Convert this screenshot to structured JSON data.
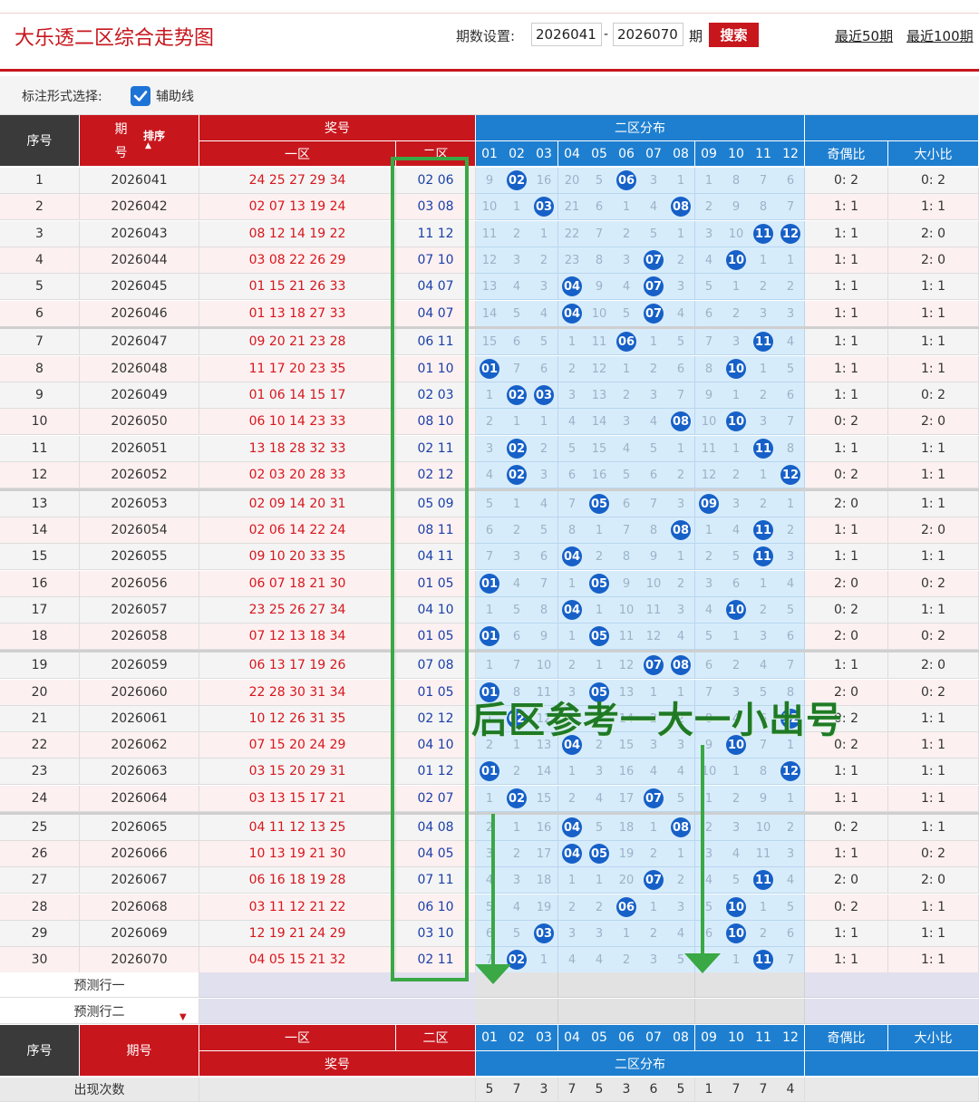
{
  "header": {
    "title": "大乐透二区综合走势图",
    "period_label": "期数设置:",
    "period_start": "2026041",
    "period_dash": "-",
    "period_end": "2026070",
    "period_unit": "期",
    "search_label": "搜索",
    "link_50": "最近50期",
    "link_100": "最近100期"
  },
  "options": {
    "label_mode": "标注形式选择:",
    "helper_line": "辅助线",
    "checked": true
  },
  "table_header": {
    "seq": "序号",
    "period_top": "期",
    "period_bottom": "号",
    "sort": "排序",
    "draw": "奖号",
    "front": "一区",
    "back": "二区",
    "zone": "二区分布",
    "zone_cols": [
      "01",
      "02",
      "03",
      "04",
      "05",
      "06",
      "07",
      "08",
      "09",
      "10",
      "11",
      "12"
    ],
    "odd_even": "奇偶比",
    "big_small": "大小比"
  },
  "rows": [
    {
      "seq": "1",
      "period": "2026041",
      "front": "24 25 27 29 34",
      "back": "02 06",
      "zone": [
        "9",
        "02",
        "16",
        "20",
        "5",
        "06",
        "3",
        "1",
        "1",
        "8",
        "7",
        "6"
      ],
      "odd_even": "0: 2",
      "big_small": "0: 2"
    },
    {
      "seq": "2",
      "period": "2026042",
      "front": "02 07 13 19 24",
      "back": "03 08",
      "zone": [
        "10",
        "1",
        "03",
        "21",
        "6",
        "1",
        "4",
        "08",
        "2",
        "9",
        "8",
        "7"
      ],
      "odd_even": "1: 1",
      "big_small": "1: 1"
    },
    {
      "seq": "3",
      "period": "2026043",
      "front": "08 12 14 19 22",
      "back": "11 12",
      "zone": [
        "11",
        "2",
        "1",
        "22",
        "7",
        "2",
        "5",
        "1",
        "3",
        "10",
        "11",
        "12"
      ],
      "odd_even": "1: 1",
      "big_small": "2: 0"
    },
    {
      "seq": "4",
      "period": "2026044",
      "front": "03 08 22 26 29",
      "back": "07 10",
      "zone": [
        "12",
        "3",
        "2",
        "23",
        "8",
        "3",
        "07",
        "2",
        "4",
        "10",
        "1",
        "1"
      ],
      "odd_even": "1: 1",
      "big_small": "2: 0"
    },
    {
      "seq": "5",
      "period": "2026045",
      "front": "01 15 21 26 33",
      "back": "04 07",
      "zone": [
        "13",
        "4",
        "3",
        "04",
        "9",
        "4",
        "07",
        "3",
        "5",
        "1",
        "2",
        "2"
      ],
      "odd_even": "1: 1",
      "big_small": "1: 1"
    },
    {
      "seq": "6",
      "period": "2026046",
      "front": "01 13 18 27 33",
      "back": "04 07",
      "zone": [
        "14",
        "5",
        "4",
        "04",
        "10",
        "5",
        "07",
        "4",
        "6",
        "2",
        "3",
        "3"
      ],
      "odd_even": "1: 1",
      "big_small": "1: 1"
    },
    {
      "seq": "7",
      "period": "2026047",
      "front": "09 20 21 23 28",
      "back": "06 11",
      "zone": [
        "15",
        "6",
        "5",
        "1",
        "11",
        "06",
        "1",
        "5",
        "7",
        "3",
        "11",
        "4"
      ],
      "odd_even": "1: 1",
      "big_small": "1: 1"
    },
    {
      "seq": "8",
      "period": "2026048",
      "front": "11 17 20 23 35",
      "back": "01 10",
      "zone": [
        "01",
        "7",
        "6",
        "2",
        "12",
        "1",
        "2",
        "6",
        "8",
        "10",
        "1",
        "5"
      ],
      "odd_even": "1: 1",
      "big_small": "1: 1"
    },
    {
      "seq": "9",
      "period": "2026049",
      "front": "01 06 14 15 17",
      "back": "02 03",
      "zone": [
        "1",
        "02",
        "03",
        "3",
        "13",
        "2",
        "3",
        "7",
        "9",
        "1",
        "2",
        "6"
      ],
      "odd_even": "1: 1",
      "big_small": "0: 2"
    },
    {
      "seq": "10",
      "period": "2026050",
      "front": "06 10 14 23 33",
      "back": "08 10",
      "zone": [
        "2",
        "1",
        "1",
        "4",
        "14",
        "3",
        "4",
        "08",
        "10",
        "10",
        "3",
        "7"
      ],
      "odd_even": "0: 2",
      "big_small": "2: 0"
    },
    {
      "seq": "11",
      "period": "2026051",
      "front": "13 18 28 32 33",
      "back": "02 11",
      "zone": [
        "3",
        "02",
        "2",
        "5",
        "15",
        "4",
        "5",
        "1",
        "11",
        "1",
        "11",
        "8"
      ],
      "odd_even": "1: 1",
      "big_small": "1: 1"
    },
    {
      "seq": "12",
      "period": "2026052",
      "front": "02 03 20 28 33",
      "back": "02 12",
      "zone": [
        "4",
        "02",
        "3",
        "6",
        "16",
        "5",
        "6",
        "2",
        "12",
        "2",
        "1",
        "12"
      ],
      "odd_even": "0: 2",
      "big_small": "1: 1"
    },
    {
      "seq": "13",
      "period": "2026053",
      "front": "02 09 14 20 31",
      "back": "05 09",
      "zone": [
        "5",
        "1",
        "4",
        "7",
        "05",
        "6",
        "7",
        "3",
        "09",
        "3",
        "2",
        "1"
      ],
      "odd_even": "2: 0",
      "big_small": "1: 1"
    },
    {
      "seq": "14",
      "period": "2026054",
      "front": "02 06 14 22 24",
      "back": "08 11",
      "zone": [
        "6",
        "2",
        "5",
        "8",
        "1",
        "7",
        "8",
        "08",
        "1",
        "4",
        "11",
        "2"
      ],
      "odd_even": "1: 1",
      "big_small": "2: 0"
    },
    {
      "seq": "15",
      "period": "2026055",
      "front": "09 10 20 33 35",
      "back": "04 11",
      "zone": [
        "7",
        "3",
        "6",
        "04",
        "2",
        "8",
        "9",
        "1",
        "2",
        "5",
        "11",
        "3"
      ],
      "odd_even": "1: 1",
      "big_small": "1: 1"
    },
    {
      "seq": "16",
      "period": "2026056",
      "front": "06 07 18 21 30",
      "back": "01 05",
      "zone": [
        "01",
        "4",
        "7",
        "1",
        "05",
        "9",
        "10",
        "2",
        "3",
        "6",
        "1",
        "4"
      ],
      "odd_even": "2: 0",
      "big_small": "0: 2"
    },
    {
      "seq": "17",
      "period": "2026057",
      "front": "23 25 26 27 34",
      "back": "04 10",
      "zone": [
        "1",
        "5",
        "8",
        "04",
        "1",
        "10",
        "11",
        "3",
        "4",
        "10",
        "2",
        "5"
      ],
      "odd_even": "0: 2",
      "big_small": "1: 1"
    },
    {
      "seq": "18",
      "period": "2026058",
      "front": "07 12 13 18 34",
      "back": "01 05",
      "zone": [
        "01",
        "6",
        "9",
        "1",
        "05",
        "11",
        "12",
        "4",
        "5",
        "1",
        "3",
        "6"
      ],
      "odd_even": "2: 0",
      "big_small": "0: 2"
    },
    {
      "seq": "19",
      "period": "2026059",
      "front": "06 13 17 19 26",
      "back": "07 08",
      "zone": [
        "1",
        "7",
        "10",
        "2",
        "1",
        "12",
        "07",
        "08",
        "6",
        "2",
        "4",
        "7"
      ],
      "odd_even": "1: 1",
      "big_small": "2: 0"
    },
    {
      "seq": "20",
      "period": "2026060",
      "front": "22 28 30 31 34",
      "back": "01 05",
      "zone": [
        "01",
        "8",
        "11",
        "3",
        "05",
        "13",
        "1",
        "1",
        "7",
        "3",
        "5",
        "8"
      ],
      "odd_even": "2: 0",
      "big_small": "0: 2"
    },
    {
      "seq": "21",
      "period": "2026061",
      "front": "10 12 26 31 35",
      "back": "02 12",
      "zone": [
        "1",
        "02",
        "12",
        "4",
        "1",
        "14",
        "2",
        "2",
        "8",
        "4",
        "6",
        "12"
      ],
      "odd_even": "0: 2",
      "big_small": "1: 1"
    },
    {
      "seq": "22",
      "period": "2026062",
      "front": "07 15 20 24 29",
      "back": "04 10",
      "zone": [
        "2",
        "1",
        "13",
        "04",
        "2",
        "15",
        "3",
        "3",
        "9",
        "10",
        "7",
        "1"
      ],
      "odd_even": "0: 2",
      "big_small": "1: 1"
    },
    {
      "seq": "23",
      "period": "2026063",
      "front": "03 15 20 29 31",
      "back": "01 12",
      "zone": [
        "01",
        "2",
        "14",
        "1",
        "3",
        "16",
        "4",
        "4",
        "10",
        "1",
        "8",
        "12"
      ],
      "odd_even": "1: 1",
      "big_small": "1: 1"
    },
    {
      "seq": "24",
      "period": "2026064",
      "front": "03 13 15 17 21",
      "back": "02 07",
      "zone": [
        "1",
        "02",
        "15",
        "2",
        "4",
        "17",
        "07",
        "5",
        "1",
        "2",
        "9",
        "1"
      ],
      "odd_even": "1: 1",
      "big_small": "1: 1"
    },
    {
      "seq": "25",
      "period": "2026065",
      "front": "04 11 12 13 25",
      "back": "04 08",
      "zone": [
        "2",
        "1",
        "16",
        "04",
        "5",
        "18",
        "1",
        "08",
        "2",
        "3",
        "10",
        "2"
      ],
      "odd_even": "0: 2",
      "big_small": "1: 1"
    },
    {
      "seq": "26",
      "period": "2026066",
      "front": "10 13 19 21 30",
      "back": "04 05",
      "zone": [
        "3",
        "2",
        "17",
        "04",
        "05",
        "19",
        "2",
        "1",
        "3",
        "4",
        "11",
        "3"
      ],
      "odd_even": "1: 1",
      "big_small": "0: 2"
    },
    {
      "seq": "27",
      "period": "2026067",
      "front": "06 16 18 19 28",
      "back": "07 11",
      "zone": [
        "4",
        "3",
        "18",
        "1",
        "1",
        "20",
        "07",
        "2",
        "4",
        "5",
        "11",
        "4"
      ],
      "odd_even": "2: 0",
      "big_small": "2: 0"
    },
    {
      "seq": "28",
      "period": "2026068",
      "front": "03 11 12 21 22",
      "back": "06 10",
      "zone": [
        "5",
        "4",
        "19",
        "2",
        "2",
        "06",
        "1",
        "3",
        "5",
        "10",
        "1",
        "5"
      ],
      "odd_even": "0: 2",
      "big_small": "1: 1"
    },
    {
      "seq": "29",
      "period": "2026069",
      "front": "12 19 21 24 29",
      "back": "03 10",
      "zone": [
        "6",
        "5",
        "03",
        "3",
        "3",
        "1",
        "2",
        "4",
        "6",
        "10",
        "2",
        "6"
      ],
      "odd_even": "1: 1",
      "big_small": "1: 1"
    },
    {
      "seq": "30",
      "period": "2026070",
      "front": "04 05 15 21 32",
      "back": "02 11",
      "zone": [
        "7",
        "02",
        "1",
        "4",
        "4",
        "2",
        "3",
        "5",
        "7",
        "1",
        "11",
        "7"
      ],
      "odd_even": "1: 1",
      "big_small": "1: 1"
    }
  ],
  "predict": {
    "row1": "预测行一",
    "row2": "预测行二"
  },
  "footer_header": {
    "seq": "序号",
    "period": "期号",
    "front": "一区",
    "back": "二区",
    "draw": "奖号",
    "zone": "二区分布",
    "zone_cols": [
      "01",
      "02",
      "03",
      "04",
      "05",
      "06",
      "07",
      "08",
      "09",
      "10",
      "11",
      "12"
    ],
    "odd_even": "奇偶比",
    "big_small": "大小比"
  },
  "stats": {
    "label": "出现次数",
    "counts": [
      "5",
      "7",
      "3",
      "7",
      "5",
      "3",
      "6",
      "5",
      "1",
      "7",
      "7",
      "4"
    ]
  },
  "annotation": {
    "text": "后区参考一大一小出号"
  },
  "colors": {
    "red": "#c8161d",
    "blue": "#1e7fd0",
    "ball": "#1660c8",
    "zone_bg": "#d7ecfb",
    "green": "#3aa845"
  }
}
